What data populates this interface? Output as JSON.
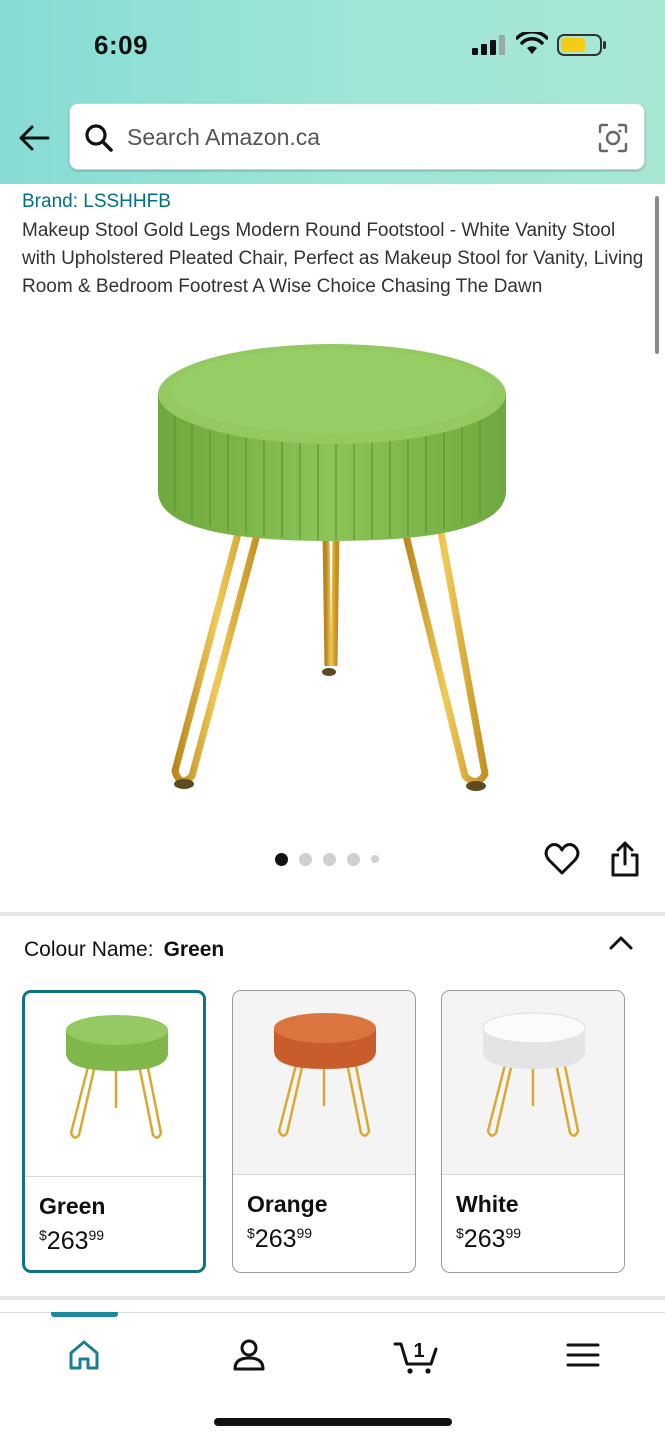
{
  "status_bar": {
    "time": "6:09"
  },
  "search": {
    "placeholder": "Search Amazon.ca"
  },
  "product": {
    "brand": "Brand: LSSHHFB",
    "title": "Makeup Stool Gold Legs Modern Round Footstool - White Vanity Stool with Upholstered Pleated Chair, Perfect as Makeup Stool for Vanity, Living Room & Bedroom Footrest A Wise Choice Chasing The Dawn",
    "image_count": 5,
    "active_image": 1
  },
  "colour": {
    "label": "Colour Name:",
    "selected": "Green",
    "options": [
      {
        "name": "Green",
        "currency": "$",
        "whole": "263",
        "fraction": "99",
        "color": "#8bc256"
      },
      {
        "name": "Orange",
        "currency": "$",
        "whole": "263",
        "fraction": "99",
        "color": "#d66a35"
      },
      {
        "name": "White",
        "currency": "$",
        "whole": "263",
        "fraction": "99",
        "color": "#f2f2f2"
      }
    ]
  },
  "nav": {
    "items": [
      "home-icon",
      "account-icon",
      "cart-icon",
      "menu-icon"
    ],
    "cart_count": "1"
  },
  "colors": {
    "accent": "#007185",
    "selected_border": "#0f7285",
    "gold": "#d9a830"
  }
}
